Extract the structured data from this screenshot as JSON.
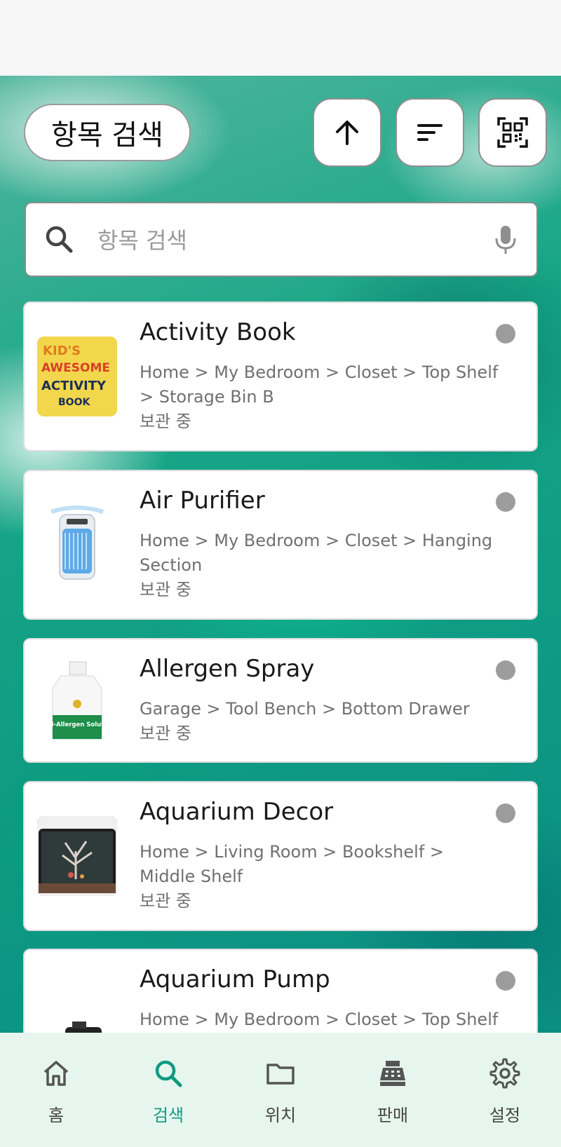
{
  "header": {
    "title": "항목 검색"
  },
  "search": {
    "placeholder": "항목 검색",
    "value": ""
  },
  "items": [
    {
      "name": "Activity Book",
      "path": "Home > My Bedroom > Closet > Top Shelf > Storage Bin B",
      "status": "보관 중"
    },
    {
      "name": "Air Purifier",
      "path": "Home > My Bedroom > Closet > Hanging Section",
      "status": "보관 중"
    },
    {
      "name": "Allergen Spray",
      "path": "Garage > Tool Bench > Bottom Drawer",
      "status": "보관 중"
    },
    {
      "name": "Aquarium Decor",
      "path": "Home > Living Room > Bookshelf > Middle Shelf",
      "status": "보관 중"
    },
    {
      "name": "Aquarium Pump",
      "path": "Home > My Bedroom > Closet > Top Shelf >",
      "status": ""
    }
  ],
  "thumb_text": {
    "activity_book": [
      "KID'S",
      "AWESOME",
      "ACTIVITY",
      "BOOK"
    ],
    "spray_label": "Anti-Allergen Solution"
  },
  "nav": [
    {
      "label": "홈",
      "icon": "home-icon"
    },
    {
      "label": "검색",
      "icon": "search-icon",
      "active": true
    },
    {
      "label": "위치",
      "icon": "folder-icon"
    },
    {
      "label": "판매",
      "icon": "cash-register-icon"
    },
    {
      "label": "설정",
      "icon": "gear-icon"
    }
  ],
  "colors": {
    "accent": "#0f9a80",
    "nav_bg": "#e6f6ee",
    "status_dot": "#9c9c9c"
  }
}
